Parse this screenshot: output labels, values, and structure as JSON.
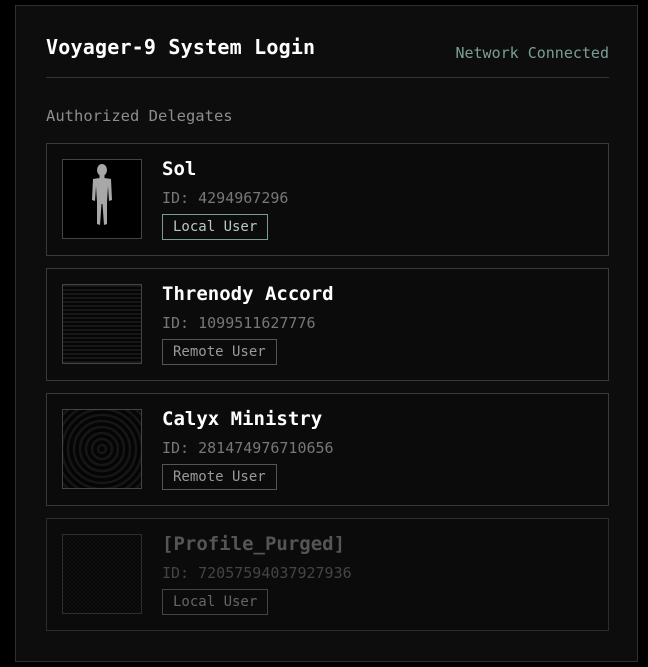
{
  "header": {
    "title": "Voyager-9 System Login",
    "network_status": "Network Connected"
  },
  "section": {
    "label": "Authorized Delegates"
  },
  "id_prefix": "ID: ",
  "users": [
    {
      "name": "Sol",
      "id": "4294967296",
      "type": "Local User",
      "avatar_icon": "human-figure-icon",
      "state": "active"
    },
    {
      "name": "Threnody Accord",
      "id": "1099511627776",
      "type": "Remote User",
      "avatar_icon": "horizontal-lines-pattern-icon",
      "state": "active"
    },
    {
      "name": "Calyx Ministry",
      "id": "281474976710656",
      "type": "Remote User",
      "avatar_icon": "concentric-circles-pattern-icon",
      "state": "active"
    },
    {
      "name": "[Profile_Purged]",
      "id": "72057594037927936",
      "type": "Local User",
      "avatar_icon": "dotted-grid-pattern-icon",
      "state": "purged"
    }
  ],
  "colors": {
    "background": "#000000",
    "panel": "#0d0d0d",
    "accent": "#7a9e96",
    "muted_text": "#777777",
    "border": "#3a3a3a"
  }
}
